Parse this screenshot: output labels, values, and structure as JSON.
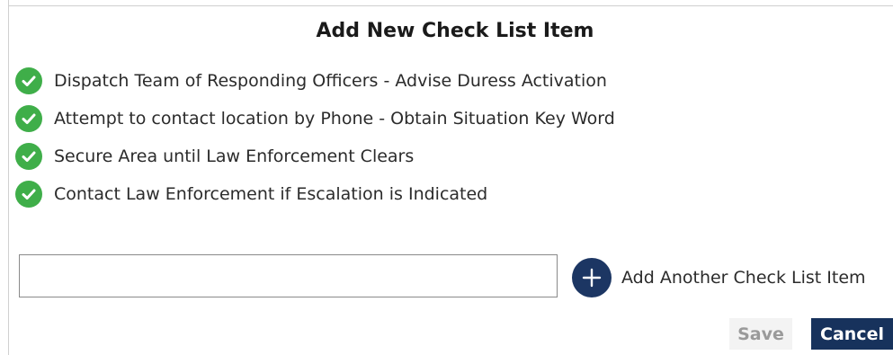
{
  "dialog": {
    "title": "Add New Check List Item"
  },
  "checklist": {
    "items": [
      {
        "label": "Dispatch Team of Responding Officers - Advise Duress Activation",
        "icon": "check-circle-icon"
      },
      {
        "label": "Attempt to contact location by Phone - Obtain Situation Key Word",
        "icon": "check-circle-icon"
      },
      {
        "label": "Secure Area until Law Enforcement Clears",
        "icon": "check-circle-icon"
      },
      {
        "label": "Contact Law Enforcement if Escalation is Indicated",
        "icon": "check-circle-icon"
      }
    ]
  },
  "new_item": {
    "value": "",
    "placeholder": ""
  },
  "add_button": {
    "label": "Add Another Check List Item",
    "icon": "plus-circle-icon"
  },
  "footer": {
    "save_label": "Save",
    "cancel_label": "Cancel"
  },
  "colors": {
    "check_green": "#3fae49",
    "navy_accent": "#17325c",
    "disabled_bg": "#f3f3f3"
  }
}
